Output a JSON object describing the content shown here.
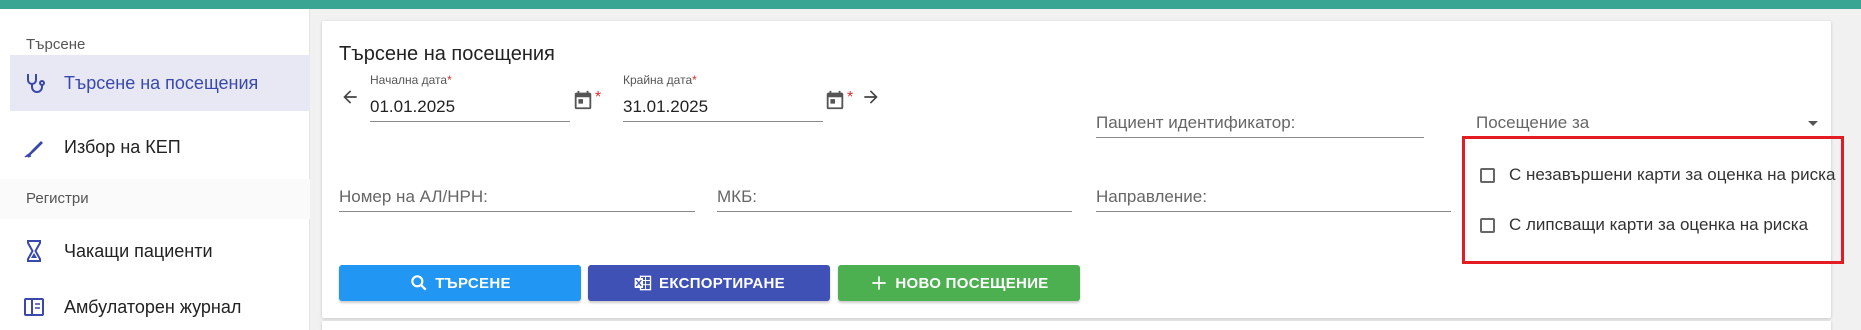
{
  "colors": {
    "topbar": "#3aa593",
    "active_item_bg": "#e7e8f4",
    "active_item_text": "#3949ab",
    "required": "#d32f2f",
    "highlight_border": "#e31b23",
    "search_button": "#2196f3",
    "export_button": "#3f51b5",
    "new_visit_button": "#4caf50"
  },
  "sidebar": {
    "section_search": "Търсене",
    "section_registers": "Регистри",
    "items": [
      {
        "label": "Търсене на посещения",
        "icon": "stethoscope-icon",
        "active": true
      },
      {
        "label": "Избор на КЕП",
        "icon": "signature-pen-icon",
        "active": false
      },
      {
        "label": "Чакащи пациенти",
        "icon": "hourglass-icon",
        "active": false
      },
      {
        "label": "Амбулаторен журнал",
        "icon": "journal-book-icon",
        "active": false
      }
    ]
  },
  "page": {
    "title": "Търсене на посещения"
  },
  "filters": {
    "start_date": {
      "label": "Начална дата",
      "required_mark": "*",
      "value": "01.01.2025"
    },
    "end_date": {
      "label": "Крайна дата",
      "required_mark": "*",
      "value": "31.01.2025"
    },
    "patient_id": {
      "placeholder": "Пациент идентификатор:"
    },
    "visit_for": {
      "placeholder": "Посещение за"
    },
    "al_nrn": {
      "placeholder": "Номер на АЛ/НРН:"
    },
    "mkb": {
      "placeholder": "МКБ:"
    },
    "referral": {
      "placeholder": "Направление:"
    },
    "checkboxes": [
      {
        "label": "С незавършени карти за оценка на риска",
        "checked": false
      },
      {
        "label": "С липсващи карти за оценка на риска",
        "checked": false
      }
    ]
  },
  "buttons": {
    "search": "ТЪРСЕНЕ",
    "export": "ЕКСПОРТИРАНЕ",
    "new_visit": "НОВО ПОСЕЩЕНИЕ"
  }
}
